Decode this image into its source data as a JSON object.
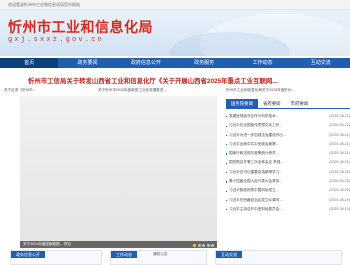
{
  "topbar": {
    "text": "欢迎登录忻州市工业和信息化局官方网站"
  },
  "banner": {
    "title": "忻州市工业和信息化局",
    "domain": "gxj.sxxz.gov.cn"
  },
  "nav": {
    "items": [
      "首页",
      "政务要闻",
      "政府信息公开",
      "政务服务",
      "工作动态",
      "互动交流"
    ]
  },
  "headline": "忻州市工信局关于转发山西省工业和信息化厅《关于开展山西省2025年重点工业互联网...",
  "ticker": [
    "关于征求《忻州市...",
    "关于忻州市2025年度新型工业化发展推进...",
    "忻州市工业和信息化局关于2025年度忻州..."
  ],
  "slider": {
    "caption": "关于2024年度国家数据... 项目",
    "active_dot": 0
  },
  "news": {
    "tabs": [
      "国务院要闻",
      "省府要闻",
      "市府要闻"
    ],
    "items": [
      {
        "title": "发展全球经济合作与科学技术...",
        "date": "(2025-08-22)"
      },
      {
        "title": "习近平在全国宣传思想文化工作...",
        "date": "(2025-08-22)"
      },
      {
        "title": "习近平为进一步加强法治建设作出...",
        "date": "(2025-08-21)"
      },
      {
        "title": "习近平出席中共中央政治局第...",
        "date": "(2025-08-21)"
      },
      {
        "title": "国家行政法规与政策统计研究...",
        "date": "(2025-08-21)"
      },
      {
        "title": "国务院召开第三次全体会议 李强...",
        "date": "(2025-08-21)"
      },
      {
        "title": "习近平总书记重要讲话精神学习...",
        "date": "(2025-08-20)"
      },
      {
        "title": "第十四届全国人民代表大会常务...",
        "date": "(2025-08-20)"
      },
      {
        "title": "习近平致信祝贺中国科协成立...",
        "date": "(2025-08-20)"
      },
      {
        "title": "习近平在西藏自治区成立60周年...",
        "date": "(2025-08-19)"
      },
      {
        "title": "习近平主持召开中央财经委员会...",
        "date": "(2025-08-19)"
      }
    ]
  },
  "bottom": {
    "public_label": "政务信息公开",
    "work_label": "工作动态",
    "interaction_label": "互动交流",
    "notice_label": "通知公告",
    "work_item": "关于忻州市工业和信息化局...",
    "work_date": "(2025-08-22)",
    "interaction_item": "局长信箱"
  }
}
